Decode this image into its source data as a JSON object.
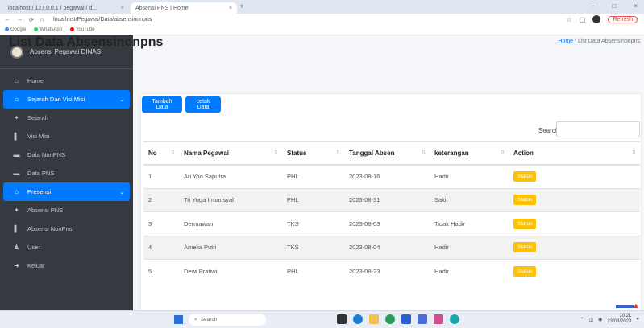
{
  "browser": {
    "tabs": [
      {
        "label": "localhost / 127.0.0.1 / pegawai / d...",
        "close": "×"
      },
      {
        "label": "Absensi PNS | Home",
        "close": "×"
      }
    ],
    "new_tab": "+",
    "window_controls": [
      "–",
      "□",
      "×"
    ],
    "nav": {
      "back": "←",
      "forward": "→",
      "reload": "⟳",
      "home": "⌂"
    },
    "url": "localhost/Pegawai/Data/absensinonpns",
    "refresh_label": "Refresh",
    "bookmarks": [
      {
        "label": "Google",
        "color": "#4285f4"
      },
      {
        "label": "WhatsApp",
        "color": "#25d366"
      },
      {
        "label": "YouTube",
        "color": "#ff0000"
      }
    ]
  },
  "sidebar": {
    "brand": "Absensi Pegawai DINAS",
    "items": [
      {
        "label": "Home",
        "icon": "home-icon",
        "glyph": "⌂",
        "active": false,
        "chevron": ""
      },
      {
        "label": "Sejarah Dan Visi Misi",
        "icon": "home-icon",
        "glyph": "⌂",
        "active": true,
        "chevron": "⌄"
      },
      {
        "label": "Sejarah",
        "icon": "pin-icon",
        "glyph": "✦",
        "active": false,
        "chevron": ""
      },
      {
        "label": "Visi Misi",
        "icon": "bar-icon",
        "glyph": "▌",
        "active": false,
        "chevron": ""
      },
      {
        "label": "Data NonPNS",
        "icon": "list-icon",
        "glyph": "▬",
        "active": false,
        "chevron": ""
      },
      {
        "label": "Data PNS",
        "icon": "list-icon",
        "glyph": "▬",
        "active": false,
        "chevron": ""
      },
      {
        "label": "Presensi",
        "icon": "home-icon",
        "glyph": "⌂",
        "active": true,
        "chevron": "⌄"
      },
      {
        "label": "Absensi PNS",
        "icon": "pin-icon",
        "glyph": "✦",
        "active": false,
        "chevron": ""
      },
      {
        "label": "Absensi NonPns",
        "icon": "bar-icon",
        "glyph": "▌",
        "active": false,
        "chevron": ""
      },
      {
        "label": "User",
        "icon": "user-icon",
        "glyph": "♟",
        "active": false,
        "chevron": ""
      },
      {
        "label": "Keluar",
        "icon": "logout-icon",
        "glyph": "➜",
        "active": false,
        "chevron": ""
      }
    ]
  },
  "main": {
    "title": "List Data Absensinonpns",
    "breadcrumb": {
      "home": "Home",
      "separator": "/",
      "current": "List Data Absensinonpns"
    },
    "buttons": {
      "add": "Tambah Data",
      "print": "cetak Data"
    },
    "search_label": "Search:",
    "table": {
      "columns": [
        "No",
        "Nama Pegawai",
        "Status",
        "Tanggal Absen",
        "keterangan",
        "Action"
      ],
      "sort_glyph": "⇅",
      "rows": [
        {
          "no": "1",
          "nama": "Ari Yoo Saputra",
          "status": "PHL",
          "tanggal": "2023-08-16",
          "ket": "Hadir",
          "action": "Status"
        },
        {
          "no": "2",
          "nama": "Tri Yoga Irmansyah",
          "status": "PHL",
          "tanggal": "2023-08-31",
          "ket": "Sakit",
          "action": "Status"
        },
        {
          "no": "3",
          "nama": "Dermawan",
          "status": "TKS",
          "tanggal": "2023-08-03",
          "ket": "Tidak Hadir",
          "action": "Status"
        },
        {
          "no": "4",
          "nama": "Amelia Putri",
          "status": "TKS",
          "tanggal": "2023-08-04",
          "ket": "Hadir",
          "action": "Status"
        },
        {
          "no": "5",
          "nama": "Dewi Pratiwi",
          "status": "PHL",
          "tanggal": "2023-08-23",
          "ket": "Hadir",
          "action": "Status"
        }
      ]
    }
  },
  "taskbar": {
    "search_placeholder": "Search",
    "clock_time": "10:21",
    "clock_date": "23/08/2023"
  },
  "colors": {
    "primary": "#007bff",
    "sidebar": "#343a40",
    "warning": "#ffc107"
  }
}
